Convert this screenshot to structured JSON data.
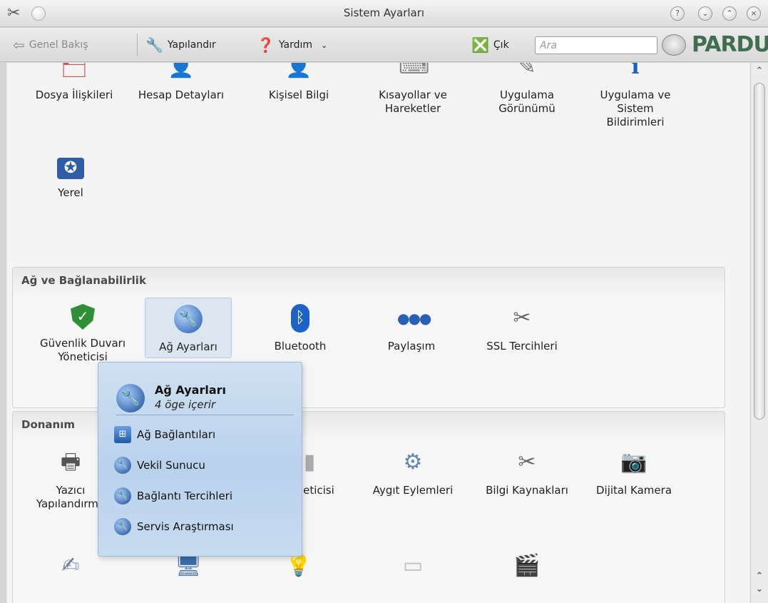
{
  "window": {
    "title": "Sistem Ayarları",
    "controls": [
      "?",
      "⌄",
      "⌃",
      "×"
    ]
  },
  "toolbar": {
    "overview": "Genel Bakış",
    "configure": "Yapılandır",
    "help": "Yardım",
    "quit": "Çık",
    "search_placeholder": "Ara",
    "logo": "PARDUS"
  },
  "top_items": [
    {
      "label": "Dosya İlişkileri",
      "icon": "file-assoc-icon"
    },
    {
      "label": "Hesap Detayları",
      "icon": "account-icon"
    },
    {
      "label": "Kişisel Bilgi",
      "icon": "personal-info-icon"
    },
    {
      "label": "Kısayollar ve Hareketler",
      "icon": "shortcuts-icon"
    },
    {
      "label": "Uygulama Görünümü",
      "icon": "appearance-icon"
    },
    {
      "label": "Uygulama ve Sistem Bildirimleri",
      "icon": "notifications-icon"
    },
    {
      "label": "Yerel",
      "icon": "locale-flag-icon"
    }
  ],
  "network_section": {
    "title": "Ağ ve Bağlanabilirlik",
    "items": [
      {
        "label": "Güvenlik Duvarı Yöneticisi",
        "icon": "firewall-shield-icon"
      },
      {
        "label": "Ağ Ayarları",
        "icon": "network-globe-icon"
      },
      {
        "label": "Bluetooth",
        "icon": "bluetooth-icon"
      },
      {
        "label": "Paylaşım",
        "icon": "sharing-icon"
      },
      {
        "label": "SSL Tercihleri",
        "icon": "ssl-tools-icon"
      }
    ]
  },
  "hardware_section": {
    "title": "Donanım",
    "items": [
      {
        "label": "Yazıcı Yapılandırma",
        "icon": "printer-icon"
      },
      {
        "label": "Yöneticisi",
        "icon": "device-manager-icon"
      },
      {
        "label": "Aygıt Eylemleri",
        "icon": "device-actions-gear-icon"
      },
      {
        "label": "Bilgi Kaynakları",
        "icon": "info-sources-icon"
      },
      {
        "label": "Dijital Kamera",
        "icon": "camera-icon"
      }
    ],
    "bottom_row_icons": [
      "tablet-icon",
      "monitor-icon",
      "bulb-icon",
      "drive-icon",
      "film-icon"
    ]
  },
  "popup": {
    "title": "Ağ Ayarları",
    "subtitle": "4 öge içerir",
    "items": [
      {
        "label": "Ağ Bağlantıları",
        "icon": "network-connections-icon"
      },
      {
        "label": "Vekil Sunucu",
        "icon": "proxy-icon"
      },
      {
        "label": "Bağlantı Tercihleri",
        "icon": "connection-prefs-icon"
      },
      {
        "label": "Servis Araştırması",
        "icon": "service-discovery-icon"
      }
    ]
  }
}
